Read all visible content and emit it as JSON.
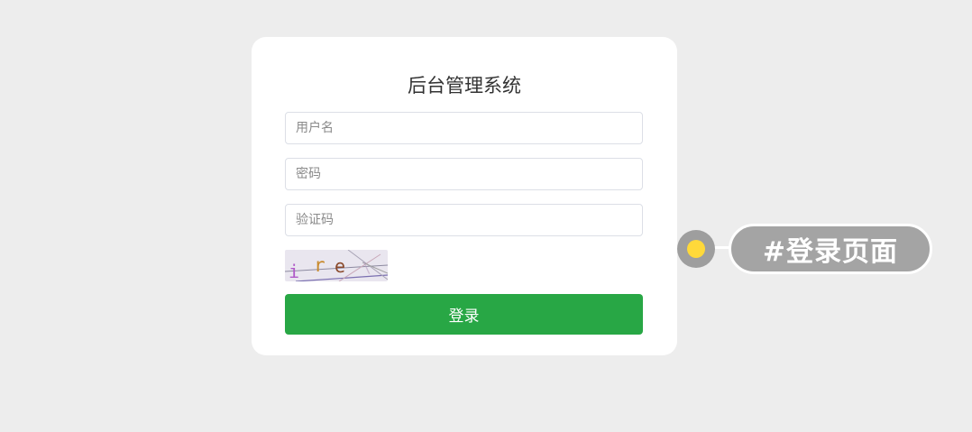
{
  "login": {
    "title": "后台管理系统",
    "username_placeholder": "用户名",
    "password_placeholder": "密码",
    "captcha_placeholder": "验证码",
    "captcha_text": "i r e",
    "submit_label": "登录"
  },
  "annotation": {
    "tag_label": "#登录页面"
  },
  "colors": {
    "primary_button": "#28a745",
    "background": "#ededed",
    "card": "#ffffff",
    "marker_dot": "#ffd93a",
    "tag_pill": "#a4a4a4"
  }
}
